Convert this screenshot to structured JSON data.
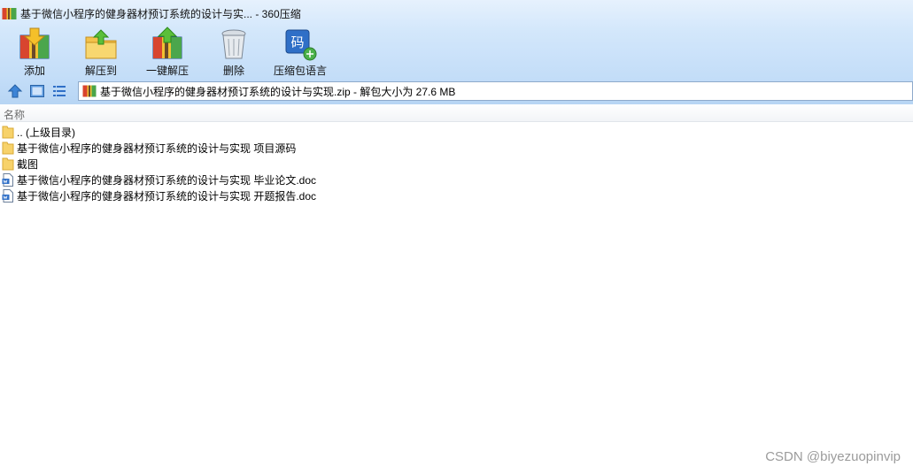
{
  "window": {
    "title": "基于微信小程序的健身器材预订系统的设计与实... - 360压缩",
    "icon": "archive-app-icon"
  },
  "toolbar": {
    "buttons": [
      {
        "label": "添加",
        "icon": "add-icon"
      },
      {
        "label": "解压到",
        "icon": "extract-to-icon"
      },
      {
        "label": "一键解压",
        "icon": "one-click-extract-icon"
      },
      {
        "label": "删除",
        "icon": "delete-icon"
      },
      {
        "label": "压缩包语言",
        "icon": "archive-language-icon"
      }
    ],
    "language_badge": "码"
  },
  "navbar": {
    "up_icon": "arrow-up-icon",
    "view_icon": "large-view-icon",
    "list_icon": "list-view-icon",
    "path": "基于微信小程序的健身器材预订系统的设计与实现.zip - 解包大小为 27.6 MB"
  },
  "filelist": {
    "column_name": "名称",
    "items": [
      {
        "label": ".. (上级目录)",
        "icon": "folder-icon"
      },
      {
        "label": "基于微信小程序的健身器材预订系统的设计与实现 项目源码",
        "icon": "folder-icon"
      },
      {
        "label": "截图",
        "icon": "folder-icon"
      },
      {
        "label": "基于微信小程序的健身器材预订系统的设计与实现 毕业论文.doc",
        "icon": "doc-file-icon"
      },
      {
        "label": "基于微信小程序的健身器材预订系统的设计与实现 开题报告.doc",
        "icon": "doc-file-icon"
      }
    ]
  },
  "watermark": "CSDN @biyezuopinvip",
  "colors": {
    "chrome_top": "#e6f1fd",
    "chrome_bottom": "#b7d5f4",
    "folder": "#f7d26a",
    "accent_blue": "#2f6fc7"
  }
}
